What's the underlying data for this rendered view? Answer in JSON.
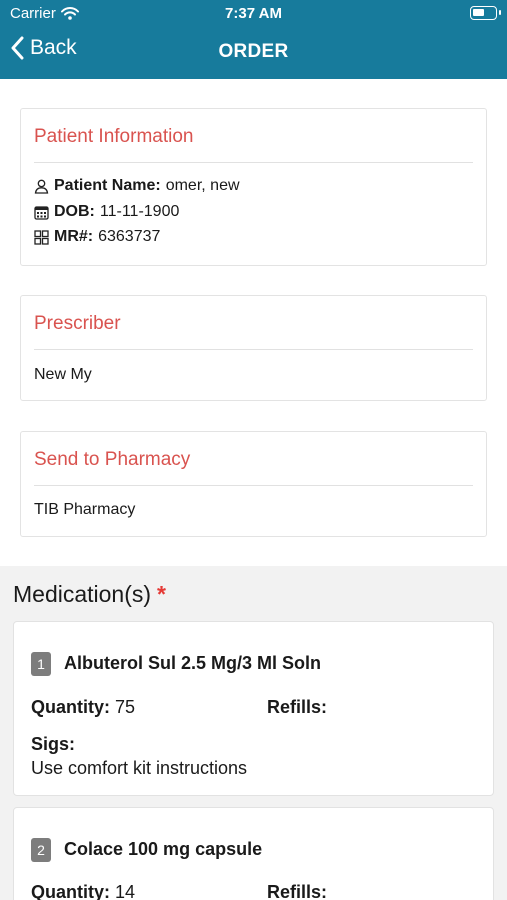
{
  "status_bar": {
    "carrier": "Carrier",
    "time": "7:37 AM"
  },
  "nav": {
    "back_label": "Back",
    "title": "ORDER"
  },
  "patient": {
    "title": "Patient Information",
    "name_label": "Patient Name:",
    "name_value": "omer, new",
    "dob_label": "DOB:",
    "dob_value": "11-11-1900",
    "mr_label": "MR#:",
    "mr_value": "6363737"
  },
  "prescriber": {
    "title": "Prescriber",
    "value": "New My"
  },
  "pharmacy": {
    "title": "Send to Pharmacy",
    "value": "TIB Pharmacy"
  },
  "medications": {
    "heading": "Medication(s)",
    "required_mark": "*",
    "items": [
      {
        "number": "1",
        "name": "Albuterol Sul 2.5 Mg/3 Ml Soln",
        "quantity_label": "Quantity:",
        "quantity": "75",
        "refills_label": "Refills:",
        "refills": "",
        "sigs_label": "Sigs:",
        "sigs": "Use comfort kit instructions"
      },
      {
        "number": "2",
        "name": "Colace 100 mg capsule",
        "quantity_label": "Quantity:",
        "quantity": "14",
        "refills_label": "Refills:",
        "refills": ""
      }
    ]
  },
  "colors": {
    "nav_bar": "#177b9c",
    "section_title": "#d9534f",
    "required": "#e53935"
  }
}
